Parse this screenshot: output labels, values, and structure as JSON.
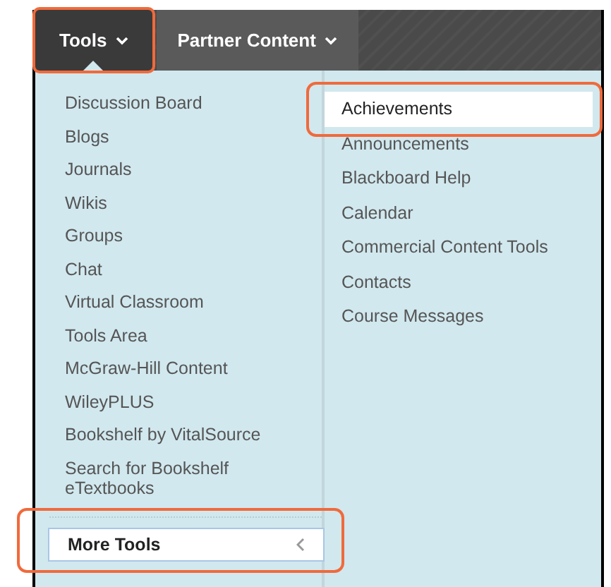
{
  "nav_tabs": [
    {
      "label": "Tools",
      "selected": true,
      "annotated": true
    },
    {
      "label": "Partner Content",
      "selected": false,
      "annotated": false
    }
  ],
  "tools_menu": {
    "left_items": [
      "Discussion Board",
      "Blogs",
      "Journals",
      "Wikis",
      "Groups",
      "Chat",
      "Virtual Classroom",
      "Tools Area",
      "McGraw-Hill Content",
      "WileyPLUS",
      "Bookshelf by VitalSource",
      "Search for Bookshelf eTextbooks"
    ],
    "right_items": [
      {
        "label": "Achievements",
        "selected": true,
        "annotated": true
      },
      {
        "label": "Announcements",
        "selected": false,
        "annotated": false
      },
      {
        "label": "Blackboard Help",
        "selected": false,
        "annotated": false
      },
      {
        "label": "Calendar",
        "selected": false,
        "annotated": false
      },
      {
        "label": "Commercial Content Tools",
        "selected": false,
        "annotated": false
      },
      {
        "label": "Contacts",
        "selected": false,
        "annotated": false
      },
      {
        "label": "Course Messages",
        "selected": false,
        "annotated": false
      }
    ],
    "more_tools": {
      "label": "More Tools",
      "annotated": true
    }
  }
}
